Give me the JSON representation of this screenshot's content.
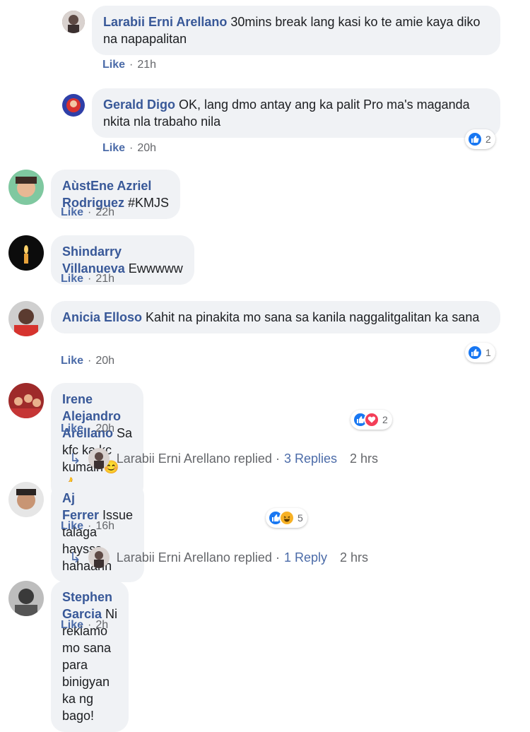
{
  "comments": [
    {
      "name": "Larabii Erni Arellano",
      "text": "30mins break lang kasi ko te amie kaya diko na napapalitan",
      "like": "Like",
      "time": "21h"
    },
    {
      "name": "Gerald Digo",
      "text": "OK, lang dmo antay ang ka palit Pro ma's maganda nkita nla trabaho nila",
      "like": "Like",
      "time": "20h",
      "reaction_count": "2"
    },
    {
      "name": "AùstEne Azriel Rodriguez",
      "text": "#KMJS",
      "like": "Like",
      "time": "22h"
    },
    {
      "name": "Shindarry Villanueva",
      "text": "Ewwwww",
      "like": "Like",
      "time": "21h"
    },
    {
      "name": "Anicia Elloso",
      "text": "Kahit na pinakita mo sana sa kanila naggalitgalitan ka sana",
      "like": "Like",
      "time": "20h",
      "reaction_count": "1"
    },
    {
      "name": "Irene Alejandro Arellano",
      "text": "Sa kfc ka kc kumain😊 👍",
      "like": "Like",
      "time": "20h",
      "reaction_count": "2"
    },
    {
      "name": "Aj Ferrer",
      "text": "Issue talaga haysss hahaahh",
      "like": "Like",
      "time": "16h",
      "reaction_count": "5"
    },
    {
      "name": "Stephen Garcia",
      "text": "Ni reklamo mo sana para binigyan ka ng bago!",
      "like": "Like",
      "time": "2h"
    }
  ],
  "replies": [
    {
      "name": "Larabii Erni Arellano",
      "action": "replied",
      "sep": "·",
      "count": "3 Replies",
      "time": "2 hrs"
    },
    {
      "name": "Larabii Erni Arellano",
      "action": "replied",
      "sep": "·",
      "count": "1 Reply",
      "time": "2 hrs"
    }
  ],
  "colors": {
    "name_link": "#385898",
    "bubble": "#f0f2f5",
    "like_blue": "#1877f2",
    "love_red": "#f33e58",
    "haha_yellow": "#f7b125"
  }
}
